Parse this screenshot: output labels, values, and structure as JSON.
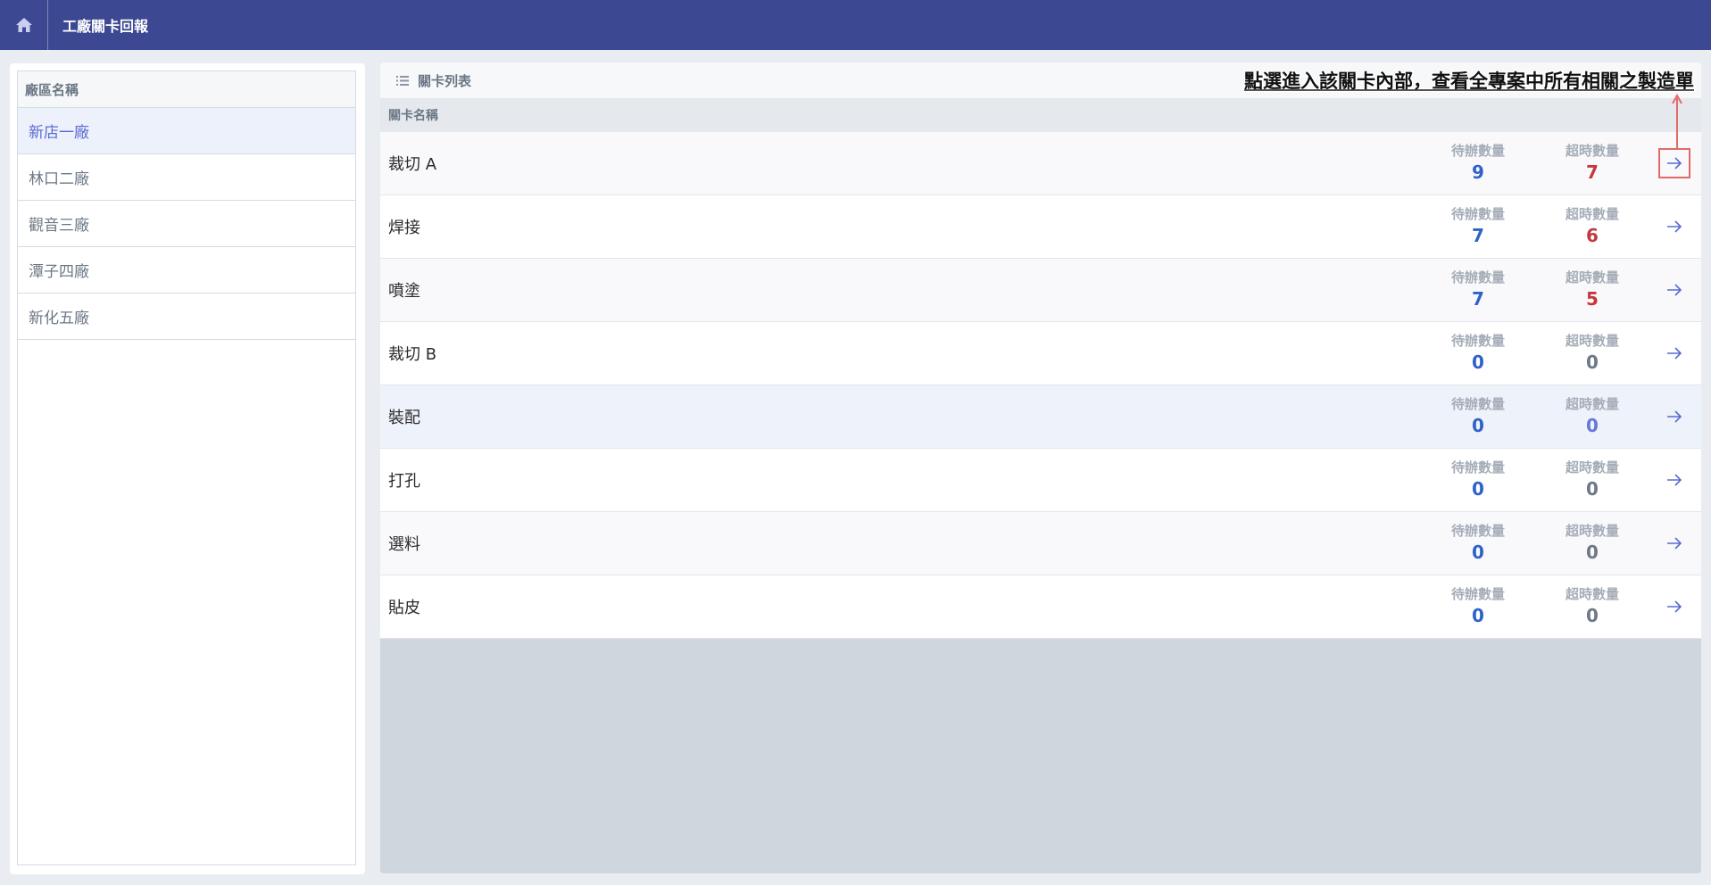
{
  "header": {
    "title": "工廠關卡回報",
    "home_icon": "home-icon",
    "bg_color": "#3c4892"
  },
  "sidebar": {
    "header": "廠區名稱",
    "items": [
      {
        "label": "新店一廠",
        "active": true
      },
      {
        "label": "林口二廠",
        "active": false
      },
      {
        "label": "觀音三廠",
        "active": false
      },
      {
        "label": "潭子四廠",
        "active": false
      },
      {
        "label": "新化五廠",
        "active": false
      }
    ]
  },
  "main": {
    "title": "關卡列表",
    "title_icon": "list-icon",
    "column_header": "關卡名稱",
    "pending_label": "待辦數量",
    "overdue_label": "超時數量",
    "rows": [
      {
        "name": "裁切 A",
        "pending": "9",
        "overdue": "7"
      },
      {
        "name": "焊接",
        "pending": "7",
        "overdue": "6"
      },
      {
        "name": "噴塗",
        "pending": "7",
        "overdue": "5"
      },
      {
        "name": "裁切 B",
        "pending": "0",
        "overdue": "0"
      },
      {
        "name": "裝配",
        "pending": "0",
        "overdue": "0"
      },
      {
        "name": "打孔",
        "pending": "0",
        "overdue": "0"
      },
      {
        "name": "選料",
        "pending": "0",
        "overdue": "0"
      },
      {
        "name": "貼皮",
        "pending": "0",
        "overdue": "0"
      }
    ]
  },
  "annotation": {
    "text": "點選進入該關卡內部，查看全專案中所有相關之製造單"
  },
  "colors": {
    "accent": "#5a6bd0",
    "pending": "#2f62c8",
    "overdue": "#c3383e",
    "highlight": "#e06a6a"
  }
}
